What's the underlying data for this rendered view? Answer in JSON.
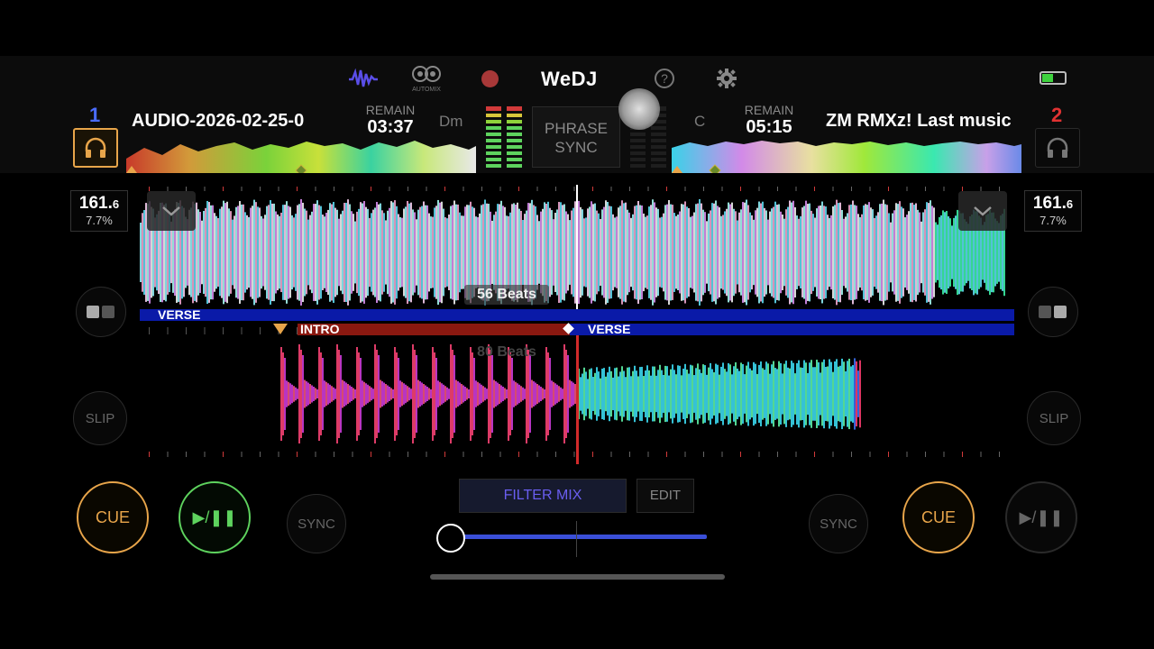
{
  "app": {
    "title": "WeDJ",
    "automix_label": "AUTOMIX"
  },
  "colors": {
    "accent_blue": "#3a4fd8",
    "deck1": "#4a6cff",
    "deck2": "#e03232",
    "cue": "#e8a54a",
    "play": "#5ed35e",
    "filter": "#5a4ee8"
  },
  "header_icons": [
    "waveform-icon",
    "automix-icon",
    "record-icon",
    "help-icon",
    "gear-icon",
    "battery-icon"
  ],
  "deck1": {
    "number": "1",
    "title": "AUDIO-2026-02-25-0",
    "remain_label": "REMAIN",
    "remain": "03:37",
    "key": "Dm",
    "bpm_int": "161.",
    "bpm_dec": "6",
    "pitch": "7.7%",
    "slip": "SLIP",
    "sync": "SYNC",
    "cue": "CUE",
    "play": "▶/❚❚"
  },
  "deck2": {
    "number": "2",
    "title": "ZM RMXz! Last music",
    "remain_label": "REMAIN",
    "remain": "05:15",
    "key": "C",
    "bpm_int": "161.",
    "bpm_dec": "6",
    "pitch": "7.7%",
    "slip": "SLIP",
    "sync": "SYNC",
    "cue": "CUE",
    "play": "▶/❚❚"
  },
  "center": {
    "phrase_sync_line1": "PHRASE",
    "phrase_sync_line2": "SYNC"
  },
  "waveforms": {
    "upper_beats": "56 Beats",
    "lower_beats": "80 Beats",
    "upper_phrase": "VERSE",
    "lower_phrase_intro": "INTRO",
    "lower_phrase_verse": "VERSE"
  },
  "mixer": {
    "filter_mix": "FILTER MIX",
    "edit": "EDIT",
    "crossfader": 0.0
  }
}
